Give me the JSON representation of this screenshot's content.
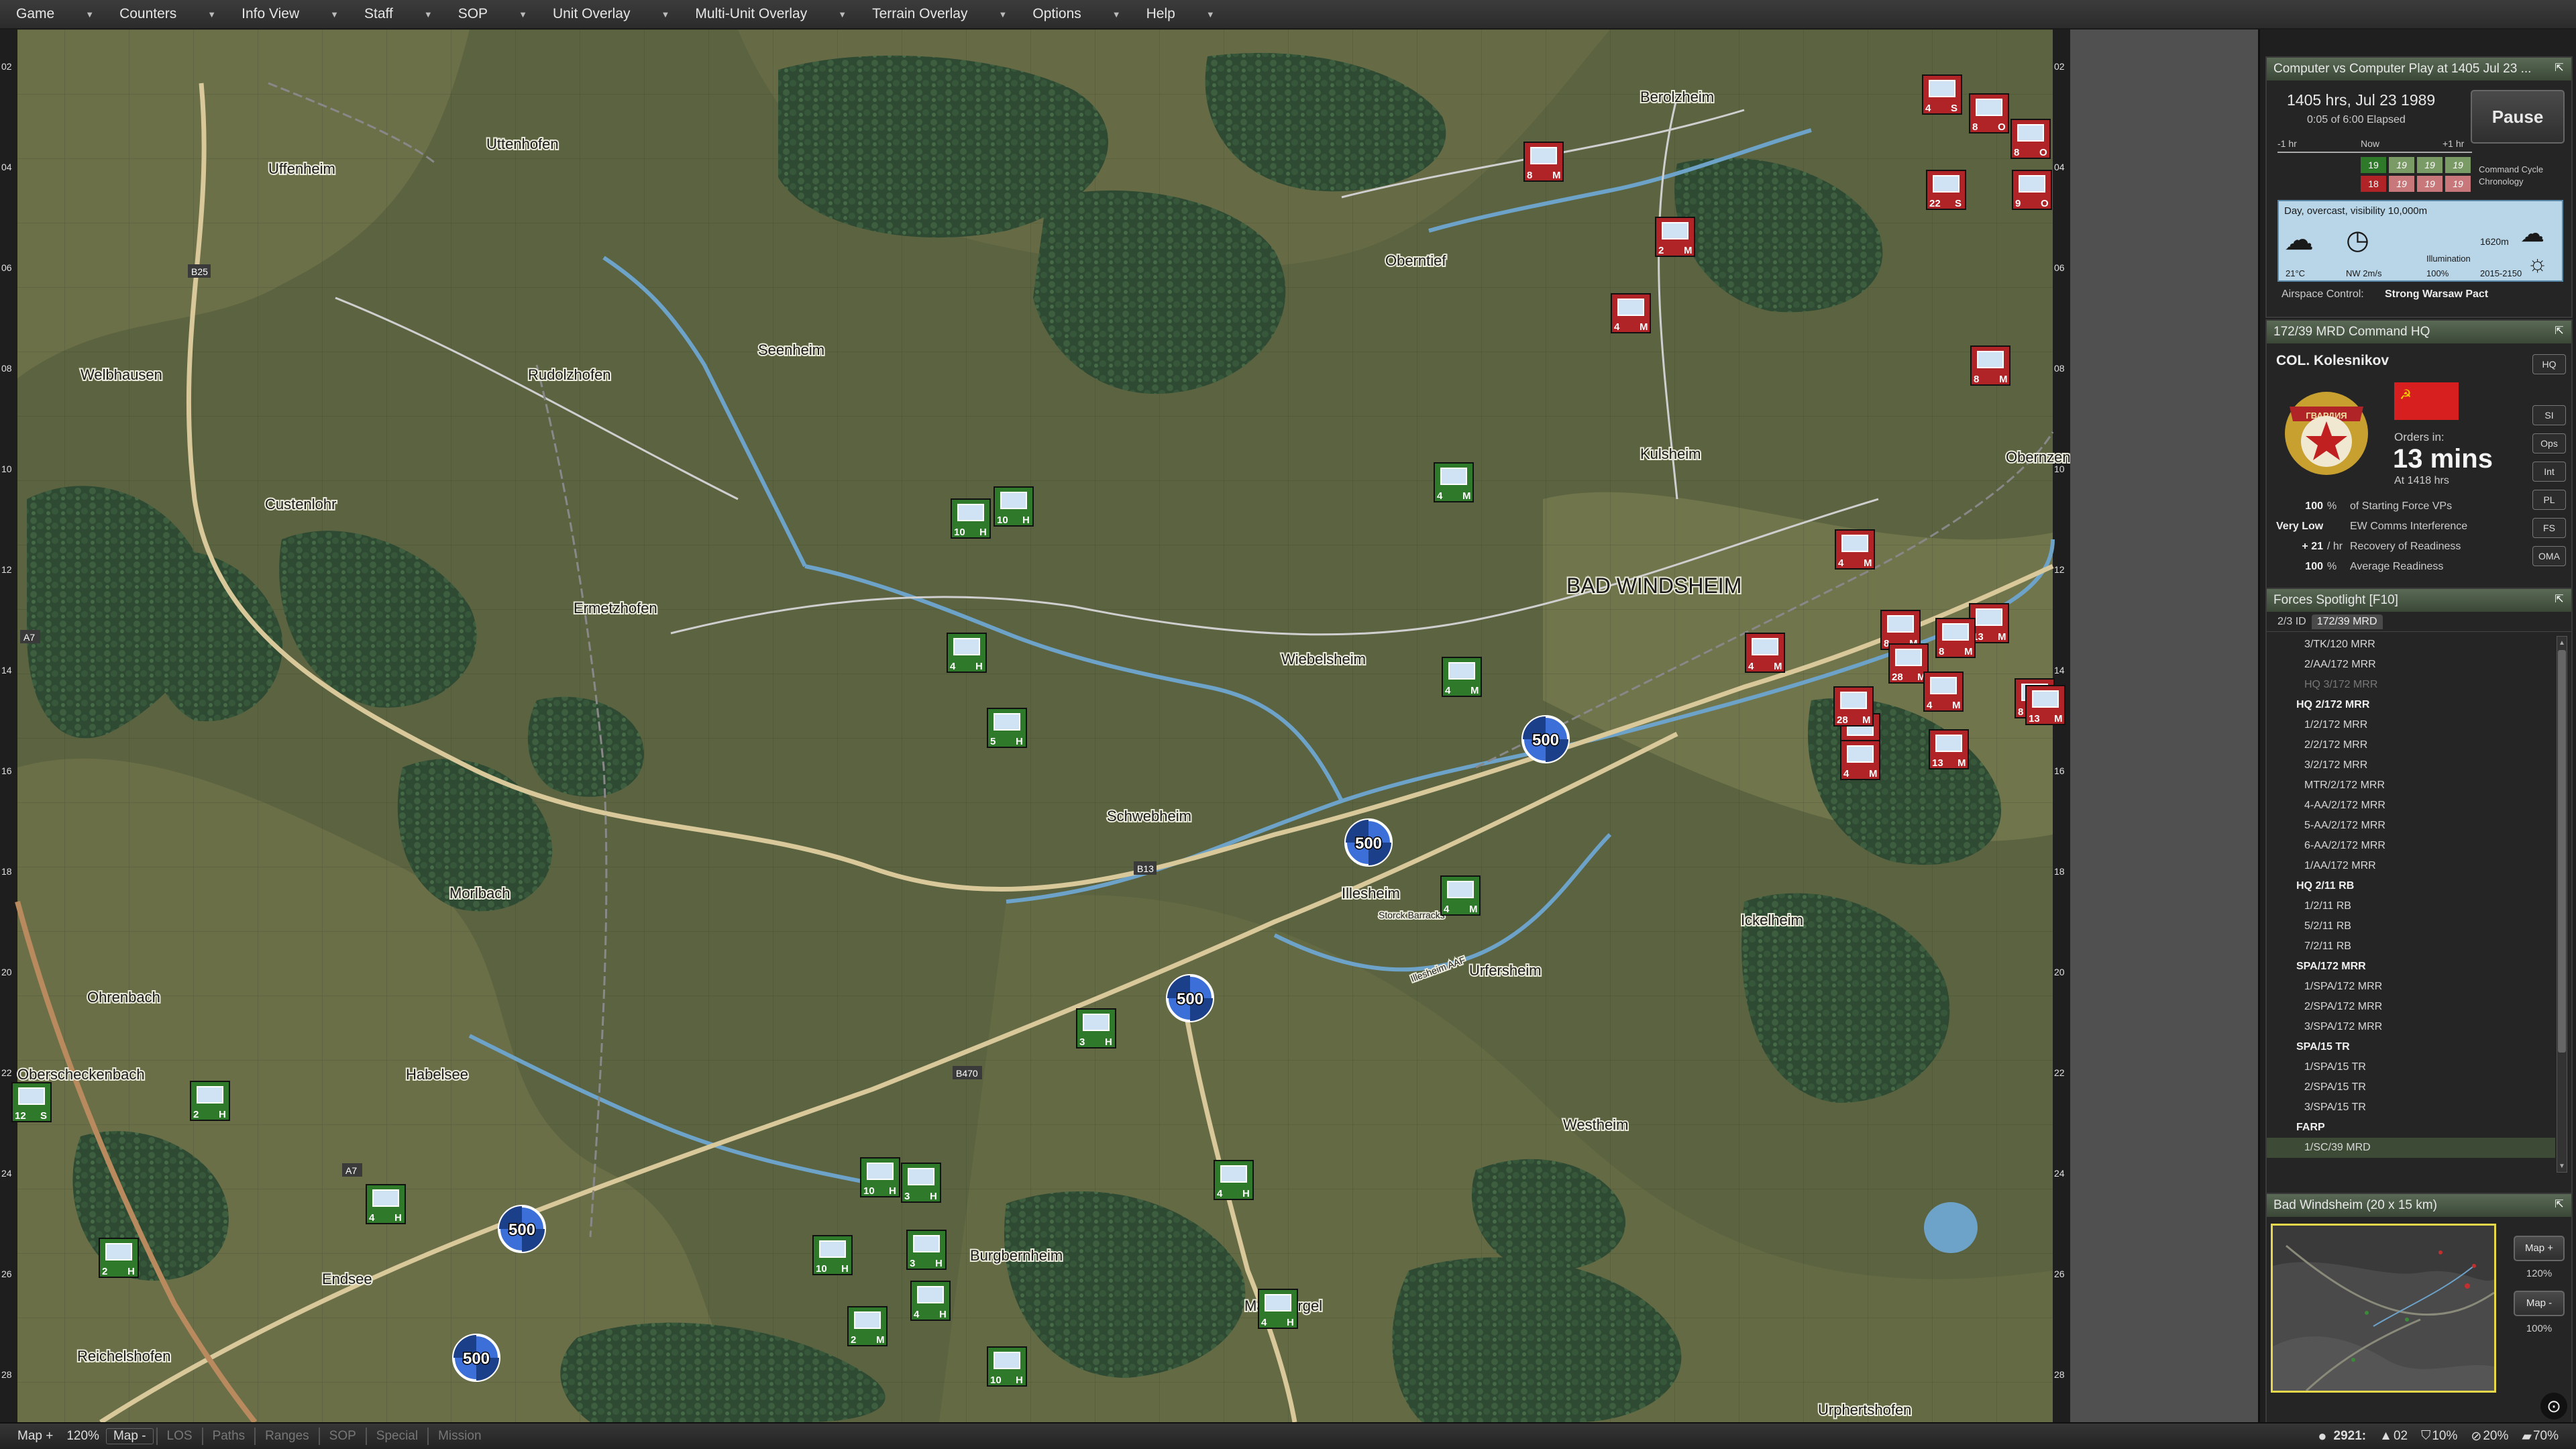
{
  "menu": [
    {
      "label": "Game"
    },
    {
      "label": "Counters"
    },
    {
      "label": "Info View"
    },
    {
      "label": "Staff"
    },
    {
      "label": "SOP"
    },
    {
      "label": "Unit Overlay"
    },
    {
      "label": "Multi-Unit Overlay"
    },
    {
      "label": "Terrain Overlay"
    },
    {
      "label": "Options"
    },
    {
      "label": "Help"
    }
  ],
  "map": {
    "towns": [
      {
        "name": "Uffenheim"
      },
      {
        "name": "Uttenhofen"
      },
      {
        "name": "Welbhausen"
      },
      {
        "name": "Rudolzhofen"
      },
      {
        "name": "Seenheim"
      },
      {
        "name": "Custenlohr"
      },
      {
        "name": "Ermetzhofen"
      },
      {
        "name": "Obernzenn"
      },
      {
        "name": "Kulsheim"
      },
      {
        "name": "BAD WINDSHEIM"
      },
      {
        "name": "Wiebelsheim"
      },
      {
        "name": "Schwebheim"
      },
      {
        "name": "Illesheim"
      },
      {
        "name": "Urfersheim"
      },
      {
        "name": "Ickelheim"
      },
      {
        "name": "Morlbach"
      },
      {
        "name": "Ohrenbach"
      },
      {
        "name": "Oberscheckenbach"
      },
      {
        "name": "Habelsee"
      },
      {
        "name": "Westheim"
      },
      {
        "name": "Endsee"
      },
      {
        "name": "Reichelshofen"
      },
      {
        "name": "Burgbernheim"
      },
      {
        "name": "Marktbergel"
      },
      {
        "name": "Oberntief"
      },
      {
        "name": "Berolzheim"
      },
      {
        "name": "Urphertshofen"
      },
      {
        "name": "Obernzenn"
      },
      {
        "name": "Illesheim AAF"
      },
      {
        "name": "Storck Barracks"
      }
    ],
    "roads": [
      "B13",
      "B25",
      "B470",
      "A7"
    ],
    "markers": [
      {
        "label": "500"
      },
      {
        "label": "500"
      },
      {
        "label": "500"
      },
      {
        "label": "500"
      },
      {
        "label": "500"
      }
    ],
    "grid_left": [
      "02",
      "04",
      "06",
      "08",
      "10",
      "12",
      "14",
      "16",
      "18",
      "20",
      "22",
      "24",
      "26",
      "28"
    ],
    "grid_right": [
      "02",
      "04",
      "06",
      "08",
      "10",
      "12",
      "14",
      "16",
      "18",
      "20",
      "22",
      "24",
      "26",
      "28"
    ],
    "units_nato": [
      {
        "tl": "10",
        "st": "H"
      },
      {
        "tl": "10",
        "st": "H"
      },
      {
        "tl": "4",
        "st": "H"
      },
      {
        "tl": "5",
        "st": "H"
      },
      {
        "tl": "4",
        "st": "M"
      },
      {
        "tl": "4",
        "st": "M"
      },
      {
        "tl": "4",
        "st": "M"
      },
      {
        "tl": "3",
        "st": "H"
      },
      {
        "tl": "2",
        "st": "H"
      },
      {
        "tl": "12",
        "st": "S"
      },
      {
        "tl": "2",
        "st": "H"
      },
      {
        "tl": "3",
        "st": "H"
      },
      {
        "tl": "10",
        "st": "H"
      },
      {
        "tl": "10",
        "st": "H"
      },
      {
        "tl": "3",
        "st": "H"
      },
      {
        "tl": "4",
        "st": "H"
      },
      {
        "tl": "2",
        "st": "M"
      },
      {
        "tl": "10",
        "st": "H"
      },
      {
        "tl": "4",
        "st": "H"
      },
      {
        "tl": "4",
        "st": "H"
      },
      {
        "tl": "4",
        "st": "H"
      }
    ],
    "units_pact": [
      {
        "tl": "4",
        "st": "S"
      },
      {
        "tl": "8",
        "st": "O"
      },
      {
        "tl": "8",
        "st": "O"
      },
      {
        "tl": "22",
        "st": "S"
      },
      {
        "tl": "9",
        "st": "O"
      },
      {
        "tl": "8",
        "st": "M"
      },
      {
        "tl": "2",
        "st": "M"
      },
      {
        "tl": "4",
        "st": "M"
      },
      {
        "tl": "8",
        "st": "M"
      },
      {
        "tl": "4",
        "st": "M"
      },
      {
        "tl": "8",
        "st": "M"
      },
      {
        "tl": "4",
        "st": "M"
      },
      {
        "tl": "13",
        "st": "M"
      },
      {
        "tl": "2",
        "st": "M"
      },
      {
        "tl": "28",
        "st": "M"
      },
      {
        "tl": "8",
        "st": "M"
      },
      {
        "tl": "28",
        "st": "M"
      },
      {
        "tl": "4",
        "st": "M"
      },
      {
        "tl": "13",
        "st": "M"
      },
      {
        "tl": "13",
        "st": "M"
      },
      {
        "tl": "4",
        "st": "M"
      },
      {
        "tl": "8",
        "st": "M"
      }
    ]
  },
  "status_panel": {
    "title": "Computer vs Computer Play at 1405 Jul 23 ...",
    "time": "1405 hrs, Jul 23 1989",
    "elapsed": "0:05 of 6:00 Elapsed",
    "pause": "Pause",
    "minus1": "-1 hr",
    "now": "Now",
    "plus1": "+1 hr",
    "cycle_nato": [
      "19",
      "19",
      "19",
      "19"
    ],
    "cycle_pact": [
      "18",
      "19",
      "19",
      "19"
    ],
    "cycle_label": "Command Cycle Chronology",
    "weather": "Day, overcast, visibility 10,000m",
    "cloud": "1620m",
    "illumination": "Illumination",
    "temp": "21°C",
    "wind": "NW 2m/s",
    "illum_pct": "100%",
    "light": "2015-2150",
    "airspace_label": "Airspace Control:",
    "airspace_value": "Strong Warsaw Pact"
  },
  "hq_panel": {
    "title": "172/39 MRD Command HQ",
    "commander": "COL. Kolesnikov",
    "badge_text": "ГВАРДИЯ",
    "orders_label": "Orders in:",
    "orders_value": "13 mins",
    "orders_at": "At 1418 hrs",
    "stats": [
      {
        "v": "100",
        "u": "%",
        "l": "of Starting Force VPs"
      },
      {
        "v": "Very Low",
        "u": "",
        "l": "EW Comms Interference"
      },
      {
        "v": "+ 21",
        "u": "/ hr",
        "l": "Recovery of Readiness"
      },
      {
        "v": "100",
        "u": "%",
        "l": "Average Readiness"
      }
    ],
    "buttons": [
      "HQ",
      "SI",
      "Ops",
      "Int",
      "PL",
      "FS",
      "OMA"
    ]
  },
  "forces_panel": {
    "title": "Forces Spotlight  [F10]",
    "tabs": [
      "2/3 ID",
      "172/39 MRD"
    ],
    "rows": [
      {
        "t": "3/TK/120 MRR",
        "k": ""
      },
      {
        "t": "2/AA/172 MRR",
        "k": ""
      },
      {
        "t": "HQ 3/172 MRR",
        "k": "dim"
      },
      {
        "t": "HQ 2/172 MRR",
        "k": "hq"
      },
      {
        "t": "1/2/172 MRR",
        "k": ""
      },
      {
        "t": "2/2/172 MRR",
        "k": ""
      },
      {
        "t": "3/2/172 MRR",
        "k": ""
      },
      {
        "t": "MTR/2/172 MRR",
        "k": ""
      },
      {
        "t": "4-AA/2/172 MRR",
        "k": ""
      },
      {
        "t": "5-AA/2/172 MRR",
        "k": ""
      },
      {
        "t": "6-AA/2/172 MRR",
        "k": ""
      },
      {
        "t": "1/AA/172 MRR",
        "k": ""
      },
      {
        "t": "HQ 2/11 RB",
        "k": "hq"
      },
      {
        "t": "1/2/11 RB",
        "k": ""
      },
      {
        "t": "5/2/11 RB",
        "k": ""
      },
      {
        "t": "7/2/11 RB",
        "k": ""
      },
      {
        "t": "SPA/172 MRR",
        "k": "hq"
      },
      {
        "t": "1/SPA/172 MRR",
        "k": ""
      },
      {
        "t": "2/SPA/172 MRR",
        "k": ""
      },
      {
        "t": "3/SPA/172 MRR",
        "k": ""
      },
      {
        "t": "SPA/15 TR",
        "k": "hq"
      },
      {
        "t": "1/SPA/15 TR",
        "k": ""
      },
      {
        "t": "2/SPA/15 TR",
        "k": ""
      },
      {
        "t": "3/SPA/15 TR",
        "k": ""
      },
      {
        "t": "FARP",
        "k": "hq"
      },
      {
        "t": "1/SC/39 MRD",
        "k": "sel"
      }
    ]
  },
  "minimap_panel": {
    "title": "Bad Windsheim (20 x 15 km)",
    "buttons": [
      "Map +",
      "120%",
      "Map -",
      "100%"
    ]
  },
  "bottom": {
    "map_plus": "Map +",
    "zoom": "120%",
    "map_minus": "Map -",
    "toggles": [
      "LOS",
      "Paths",
      "Ranges",
      "SOP",
      "Special",
      "Mission"
    ],
    "vp": "2921:",
    "v1": "02",
    "v2": "10%",
    "v3": "20%",
    "v4": "70%"
  },
  "colors": {
    "nato": "#2f7a2a",
    "pact": "#b02428",
    "marker": "#3c6fd8",
    "terrain_dark": "#4a5a34",
    "terrain_light": "#7a7a52",
    "forest": "#2d4a30",
    "river": "#6da2c9",
    "road": "#d8c89a"
  }
}
